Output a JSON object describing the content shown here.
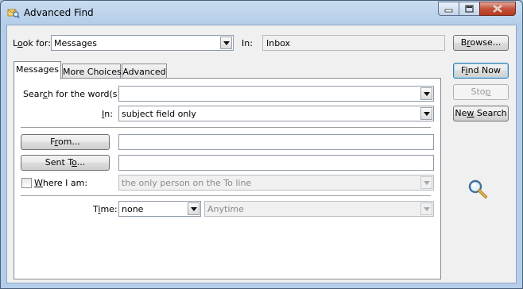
{
  "window": {
    "title": "Advanced Find",
    "icon": "advanced-find-icon",
    "controls": {
      "minimize": "minimize-icon",
      "maximize": "maximize-icon",
      "close": "close-icon"
    }
  },
  "look_for": {
    "label_pre": "L",
    "label_u": "o",
    "label_post": "ok for:",
    "value": "Messages"
  },
  "in_folder": {
    "label": "In:",
    "value": "Inbox"
  },
  "browse_button": {
    "pre": "B",
    "u": "r",
    "post": "owse..."
  },
  "tabs": [
    {
      "label": "Messages"
    },
    {
      "label": "More Choices"
    },
    {
      "label": "Advanced"
    }
  ],
  "messages_tab": {
    "search_words": {
      "pre": "Sear",
      "u": "c",
      "post": "h for the word(s):",
      "value": ""
    },
    "in_field": {
      "pre": "",
      "u": "I",
      "post": "n:",
      "value": "subject field only"
    },
    "from_button": {
      "pre": "F",
      "u": "r",
      "post": "om..."
    },
    "from_value": "",
    "sent_to_button": {
      "pre": "Sent T",
      "u": "o",
      "post": "..."
    },
    "sent_to_value": "",
    "where_i_am": {
      "pre": "",
      "u": "W",
      "post": "here I am:",
      "checked": false,
      "value": "the only person on the To line"
    },
    "time": {
      "pre": "T",
      "u": "i",
      "post": "me:",
      "value": "none",
      "range_value": "Anytime"
    }
  },
  "actions": {
    "find_now": {
      "pre": "F",
      "u": "i",
      "post": "nd Now"
    },
    "stop": {
      "pre": "Sto",
      "u": "p",
      "post": ""
    },
    "new_search": {
      "pre": "Ne",
      "u": "w",
      "post": " Search"
    }
  },
  "search_graphic": "magnifier-icon"
}
